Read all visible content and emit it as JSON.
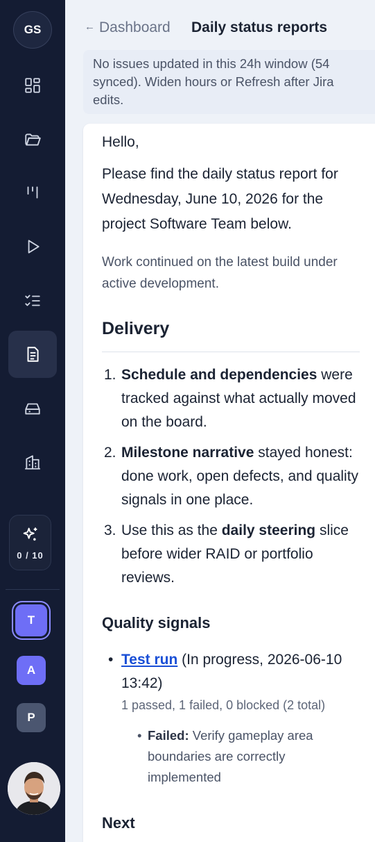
{
  "sidebar": {
    "org_initials": "GS",
    "nav_icons": [
      "grid-icon",
      "folder-icon",
      "board-icon",
      "play-icon",
      "checklist-icon",
      "report-icon",
      "inbox-icon",
      "building-icon"
    ],
    "credits": {
      "icon": "sparkle-icon",
      "count": "0 / 10"
    },
    "workspaces": [
      "T",
      "A",
      "P"
    ]
  },
  "header": {
    "back_label": "Dashboard",
    "back_arrow": "←",
    "title": "Daily status reports"
  },
  "notice": {
    "text": "No issues updated in this 24h window (54 synced). Widen hours or Refresh after Jira edits."
  },
  "report": {
    "greeting": "Hello,",
    "intro": "Please find the daily status report for Wednesday, June 10, 2026 for the project Software Team below.",
    "summary": "Work continued on the latest build under active development.",
    "delivery_heading": "Delivery",
    "delivery_items": [
      {
        "num": "1.",
        "bold": "Schedule and dependencies",
        "pre": "",
        "post": " were tracked against what actually moved on the board."
      },
      {
        "num": "2.",
        "bold": "Milestone narrative",
        "pre": "",
        "post": " stayed honest: done work, open defects, and quality signals in one place."
      },
      {
        "num": "3.",
        "bold": "daily steering",
        "pre": "Use this as the ",
        "post": " slice before wider RAID or portfolio reviews."
      }
    ],
    "quality_heading": "Quality signals",
    "test_run": {
      "link": "Test run",
      "detail": " (In progress, 2026-06-10 13:42)",
      "stats": "1 passed, 1 failed, 0 blocked (2 total)",
      "failed_label": "Failed:",
      "failed_text": " Verify gameplay area boundaries are correctly implemented"
    },
    "next_heading": "Next"
  },
  "colors": {
    "sidebar_bg": "#141c33",
    "accent": "#6e6ef6",
    "link": "#1a4fd6",
    "page_bg": "#eef2f8"
  }
}
